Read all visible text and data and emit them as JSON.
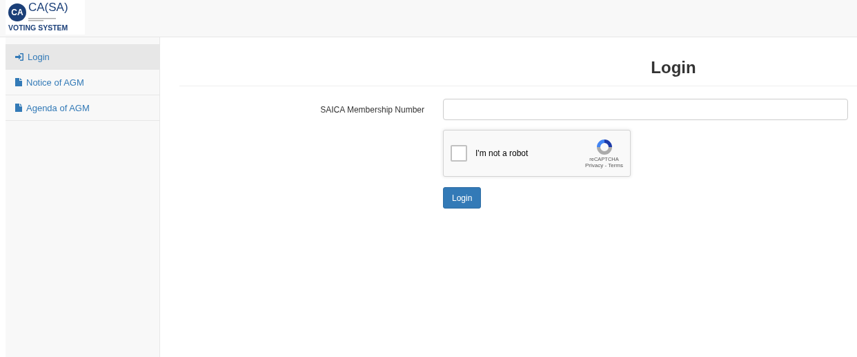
{
  "logo": {
    "mark": "CA",
    "name": "CA(SA)",
    "subtitle": "VOTING SYSTEM"
  },
  "sidebar": {
    "items": [
      {
        "label": "Login",
        "kind": "login",
        "selected": true
      },
      {
        "label": "Notice of AGM",
        "kind": "document",
        "selected": false
      },
      {
        "label": "Agenda of AGM",
        "kind": "document",
        "selected": false
      }
    ]
  },
  "page": {
    "title": "Login",
    "field": {
      "label": "SAICA Membership Number"
    },
    "captcha": {
      "label": "I'm not a robot",
      "checked": false,
      "brand": "reCAPTCHA",
      "links": "Privacy - Terms"
    },
    "button": "Login"
  }
}
